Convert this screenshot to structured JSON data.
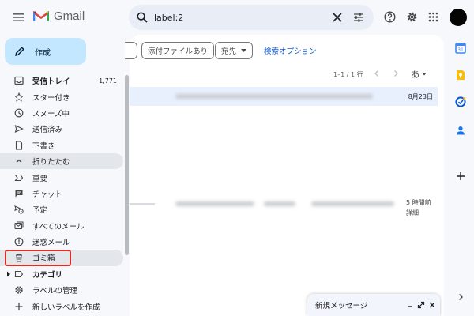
{
  "app": {
    "name": "Gmail"
  },
  "search": {
    "value": "label:2"
  },
  "compose": {
    "label": "作成"
  },
  "sidebar": {
    "items": [
      {
        "label": "受信トレイ",
        "count": "1,771"
      },
      {
        "label": "スター付き"
      },
      {
        "label": "スヌーズ中"
      },
      {
        "label": "送信済み"
      },
      {
        "label": "下書き"
      },
      {
        "label": "折りたたむ"
      },
      {
        "label": "重要"
      },
      {
        "label": "チャット"
      },
      {
        "label": "予定"
      },
      {
        "label": "すべてのメール"
      },
      {
        "label": "迷惑メール"
      },
      {
        "label": "ゴミ箱"
      },
      {
        "label": "カテゴリ"
      },
      {
        "label": "ラベルの管理"
      },
      {
        "label": "新しいラベルを作成"
      }
    ]
  },
  "filters": {
    "attachment": "添付ファイルあり",
    "to": "宛先",
    "advanced": "検索オプション"
  },
  "pager": {
    "range": "1–1 / 1 行",
    "lang": "あ"
  },
  "emails": [
    {
      "date": "8月23日"
    },
    {
      "time": "5 時間前",
      "detail": "詳細"
    }
  ],
  "mini_compose": {
    "title": "新規メッセージ"
  },
  "colors": {
    "accent": "#c2e7ff",
    "highlight_box": "#d93025",
    "selected_row": "#e8f0fe",
    "link": "#0b57d0"
  }
}
